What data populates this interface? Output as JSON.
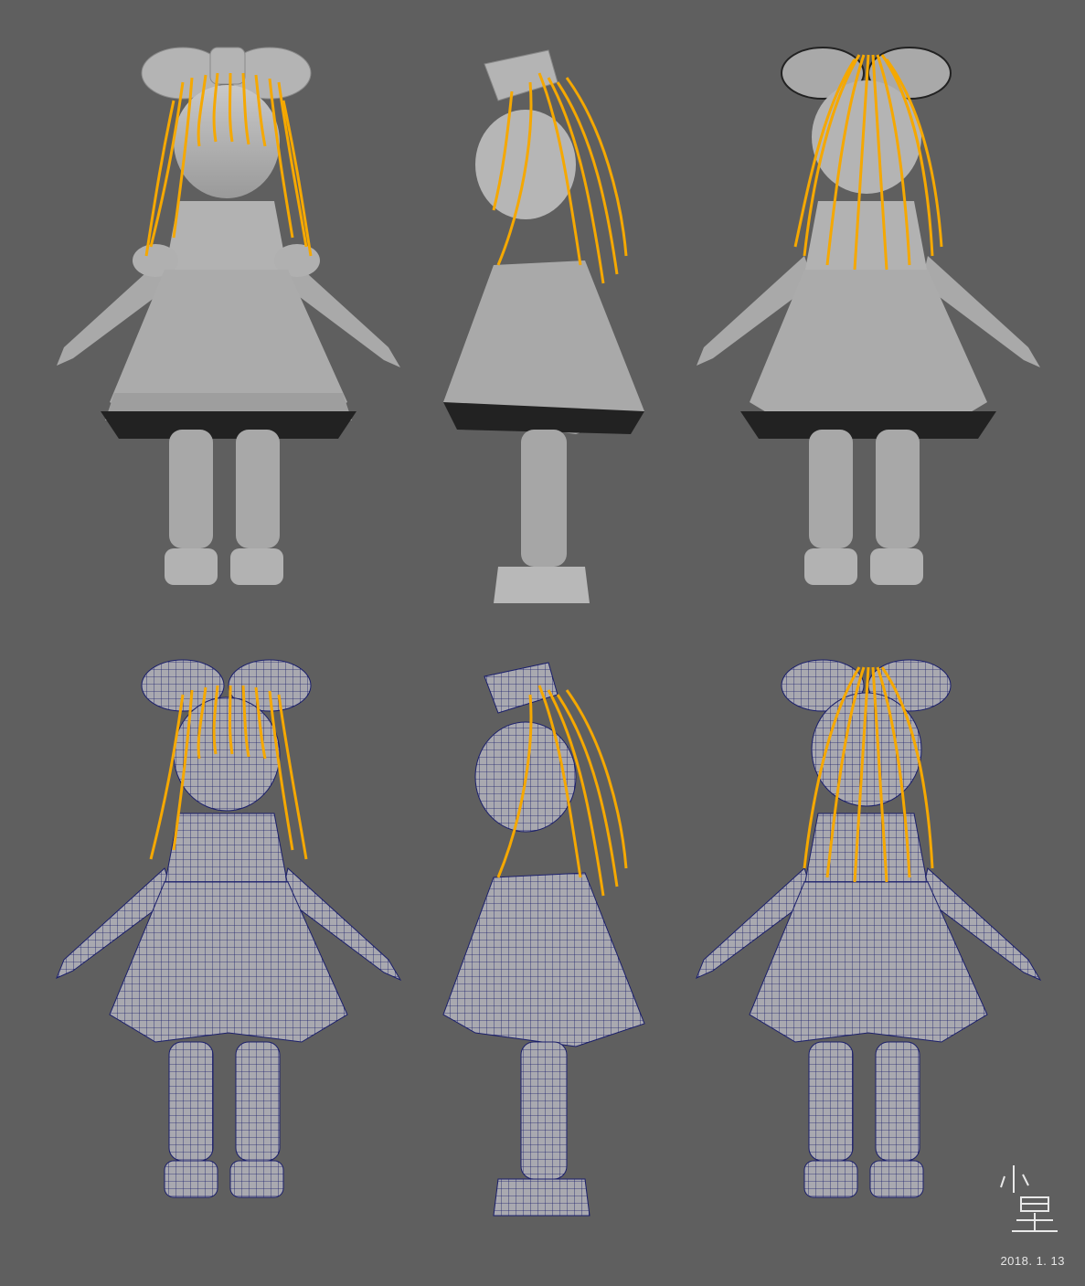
{
  "canvas": {
    "background_color": "#5f5f5f",
    "shaded_color": "#b9b9b9",
    "shadow_color": "#1a1a1a",
    "hair_color": "#f5a800",
    "wire_color": "#1b1f6b"
  },
  "views": [
    {
      "row": "shaded",
      "angle": "front"
    },
    {
      "row": "shaded",
      "angle": "side"
    },
    {
      "row": "shaded",
      "angle": "back"
    },
    {
      "row": "wireframe",
      "angle": "front"
    },
    {
      "row": "wireframe",
      "angle": "side"
    },
    {
      "row": "wireframe",
      "angle": "back"
    }
  ],
  "watermark": {
    "signature_text": "小星",
    "date": "2018. 1. 13"
  }
}
